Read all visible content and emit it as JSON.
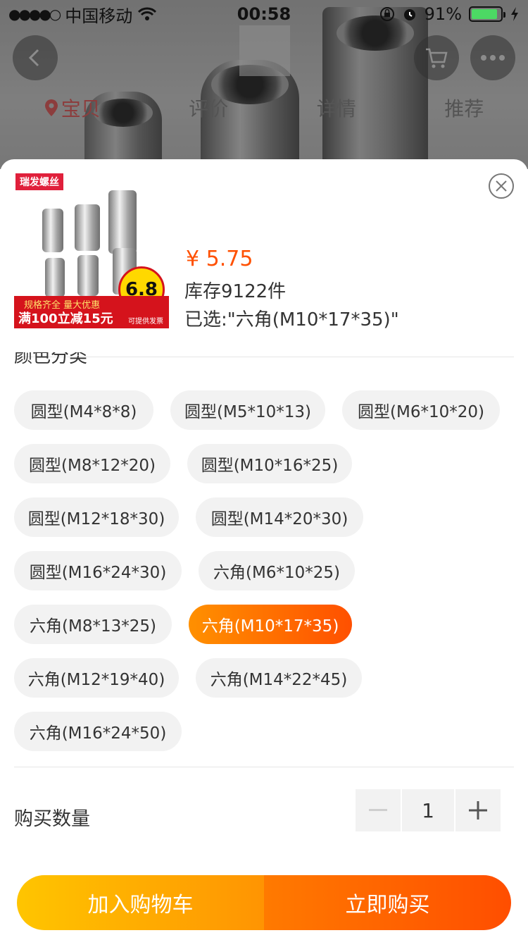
{
  "status_bar": {
    "signal": "●●●●○",
    "carrier": "中国移动",
    "time": "00:58",
    "battery_percent": "91%",
    "battery_level": 0.91,
    "icons": [
      "wifi-icon",
      "orientation-lock-icon",
      "alarm-icon",
      "battery-icon",
      "charging-icon"
    ]
  },
  "background_page": {
    "tabs": [
      {
        "label": "宝贝",
        "active": true
      },
      {
        "label": "评价",
        "active": false
      },
      {
        "label": "详情",
        "active": false
      },
      {
        "label": "推荐",
        "active": false
      }
    ]
  },
  "product": {
    "image_brand": "瑞发螺丝",
    "image_banner_top": "规格齐全  量大优惠",
    "image_banner_main": "满100立减15元",
    "image_price_badge": "6.8",
    "image_badge_note": "可提供发票",
    "price": "¥ 5.75",
    "stock": "库存9122件",
    "selected": "已选:\"六角(M10*17*35)\""
  },
  "sku": {
    "section_title": "颜色分类",
    "options": [
      {
        "label": "圆型(M4*8*8)",
        "selected": false
      },
      {
        "label": "圆型(M5*10*13)",
        "selected": false
      },
      {
        "label": "圆型(M6*10*20)",
        "selected": false
      },
      {
        "label": "圆型(M8*12*20)",
        "selected": false
      },
      {
        "label": "圆型(M10*16*25)",
        "selected": false
      },
      {
        "label": "圆型(M12*18*30)",
        "selected": false
      },
      {
        "label": "圆型(M14*20*30)",
        "selected": false
      },
      {
        "label": "圆型(M16*24*30)",
        "selected": false
      },
      {
        "label": "六角(M6*10*25)",
        "selected": false
      },
      {
        "label": "六角(M8*13*25)",
        "selected": false
      },
      {
        "label": "六角(M10*17*35)",
        "selected": true
      },
      {
        "label": "六角(M12*19*40)",
        "selected": false
      },
      {
        "label": "六角(M14*22*45)",
        "selected": false
      },
      {
        "label": "六角(M16*24*50)",
        "selected": false
      }
    ]
  },
  "quantity": {
    "label": "购买数量",
    "value": "1",
    "minus": "−",
    "plus": "+"
  },
  "actions": {
    "add_to_cart": "加入购物车",
    "buy_now": "立即购买"
  },
  "colors": {
    "accent": "#ff5000",
    "cart_gradient_start": "#ffc500",
    "buy_gradient_end": "#ff4e00"
  }
}
